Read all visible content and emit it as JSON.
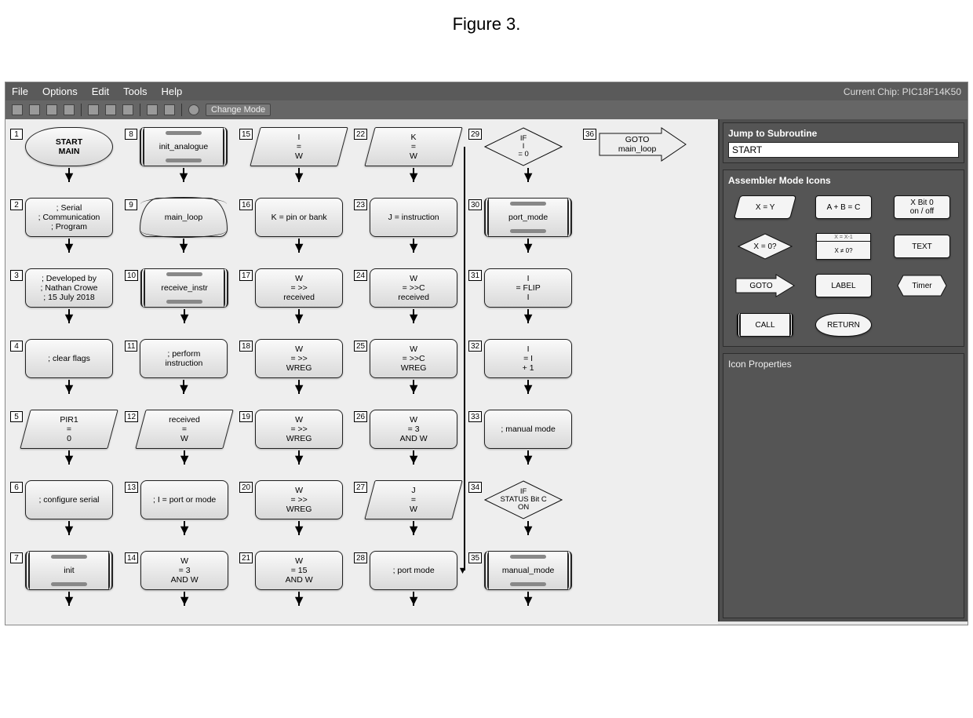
{
  "figure_title": "Figure 3.",
  "menubar": {
    "items": [
      "File",
      "Options",
      "Edit",
      "Tools",
      "Help"
    ],
    "chip_label": "Current Chip: PIC18F14K50"
  },
  "toolbar": {
    "change_mode": "Change Mode"
  },
  "side": {
    "jump_title": "Jump to Subroutine",
    "jump_value": "START",
    "palette_title": "Assembler Mode Icons",
    "properties_title": "Icon Properties",
    "palette": [
      {
        "label": "X = Y",
        "shape": "parallelogram"
      },
      {
        "label": "A + B = C",
        "shape": "rect"
      },
      {
        "label": "X Bit 0\non / off",
        "shape": "rect"
      },
      {
        "label": "X = 0?",
        "shape": "diamond"
      },
      {
        "label": "X = X-1\nX ≠ 0?",
        "shape": "window"
      },
      {
        "label": "TEXT",
        "shape": "rect"
      },
      {
        "label": "GOTO",
        "shape": "goto"
      },
      {
        "label": "LABEL",
        "shape": "rect"
      },
      {
        "label": "Timer",
        "shape": "timer"
      },
      {
        "label": "CALL",
        "shape": "call"
      },
      {
        "label": "RETURN",
        "shape": "oval"
      }
    ]
  },
  "flow_nodes": [
    {
      "n": 1,
      "col": 0,
      "row": 0,
      "type": "start",
      "text": "START\nMAIN"
    },
    {
      "n": 2,
      "col": 0,
      "row": 1,
      "type": "text",
      "text": "; Serial\n; Communication\n; Program"
    },
    {
      "n": 3,
      "col": 0,
      "row": 2,
      "type": "text",
      "text": "; Developed by\n; Nathan Crowe\n; 15 July 2018"
    },
    {
      "n": 4,
      "col": 0,
      "row": 3,
      "type": "text",
      "text": "; clear flags"
    },
    {
      "n": 5,
      "col": 0,
      "row": 4,
      "type": "parallelogram",
      "text": "PIR1\n=\n0"
    },
    {
      "n": 6,
      "col": 0,
      "row": 5,
      "type": "text",
      "text": "; configure serial"
    },
    {
      "n": 7,
      "col": 0,
      "row": 6,
      "type": "call",
      "text": "init"
    },
    {
      "n": 8,
      "col": 1,
      "row": 0,
      "type": "call",
      "text": "init_analogue"
    },
    {
      "n": 9,
      "col": 1,
      "row": 1,
      "type": "label",
      "text": "main_loop"
    },
    {
      "n": 10,
      "col": 1,
      "row": 2,
      "type": "call",
      "text": "receive_instr"
    },
    {
      "n": 11,
      "col": 1,
      "row": 3,
      "type": "text",
      "text": "; perform\ninstruction"
    },
    {
      "n": 12,
      "col": 1,
      "row": 4,
      "type": "parallelogram",
      "text": "received\n=\nW"
    },
    {
      "n": 13,
      "col": 1,
      "row": 5,
      "type": "text",
      "text": "; I = port or mode"
    },
    {
      "n": 14,
      "col": 1,
      "row": 6,
      "type": "rect",
      "text": "W\n= 3\nAND W"
    },
    {
      "n": 15,
      "col": 2,
      "row": 0,
      "type": "parallelogram",
      "text": "I\n=\nW"
    },
    {
      "n": 16,
      "col": 2,
      "row": 1,
      "type": "text",
      "text": "K = pin or bank"
    },
    {
      "n": 17,
      "col": 2,
      "row": 2,
      "type": "rect",
      "text": "W\n= >>\nreceived"
    },
    {
      "n": 18,
      "col": 2,
      "row": 3,
      "type": "rect",
      "text": "W\n= >>\nWREG"
    },
    {
      "n": 19,
      "col": 2,
      "row": 4,
      "type": "rect",
      "text": "W\n= >>\nWREG"
    },
    {
      "n": 20,
      "col": 2,
      "row": 5,
      "type": "rect",
      "text": "W\n= >>\nWREG"
    },
    {
      "n": 21,
      "col": 2,
      "row": 6,
      "type": "rect",
      "text": "W\n= 15\nAND W"
    },
    {
      "n": 22,
      "col": 3,
      "row": 0,
      "type": "parallelogram",
      "text": "K\n=\nW"
    },
    {
      "n": 23,
      "col": 3,
      "row": 1,
      "type": "text",
      "text": "J = instruction"
    },
    {
      "n": 24,
      "col": 3,
      "row": 2,
      "type": "rect",
      "text": "W\n= >>C\nreceived"
    },
    {
      "n": 25,
      "col": 3,
      "row": 3,
      "type": "rect",
      "text": "W\n= >>C\nWREG"
    },
    {
      "n": 26,
      "col": 3,
      "row": 4,
      "type": "rect",
      "text": "W\n= 3\nAND W"
    },
    {
      "n": 27,
      "col": 3,
      "row": 5,
      "type": "parallelogram",
      "text": "J\n=\nW"
    },
    {
      "n": 28,
      "col": 3,
      "row": 6,
      "type": "text",
      "text": "; port mode"
    },
    {
      "n": 29,
      "col": 4,
      "row": 0,
      "type": "diamond",
      "text": "IF\nI\n= 0"
    },
    {
      "n": 30,
      "col": 4,
      "row": 1,
      "type": "call",
      "text": "port_mode"
    },
    {
      "n": 31,
      "col": 4,
      "row": 2,
      "type": "rect",
      "text": "I\n= FLIP\nI"
    },
    {
      "n": 32,
      "col": 4,
      "row": 3,
      "type": "rect",
      "text": "I\n= I\n+ 1"
    },
    {
      "n": 33,
      "col": 4,
      "row": 4,
      "type": "text",
      "text": "; manual mode"
    },
    {
      "n": 34,
      "col": 4,
      "row": 5,
      "type": "diamond",
      "text": "IF\nSTATUS Bit C\nON"
    },
    {
      "n": 35,
      "col": 4,
      "row": 6,
      "type": "call",
      "text": "manual_mode"
    },
    {
      "n": 36,
      "col": 5,
      "row": 0,
      "type": "goto",
      "text": "GOTO\nmain_loop"
    }
  ]
}
